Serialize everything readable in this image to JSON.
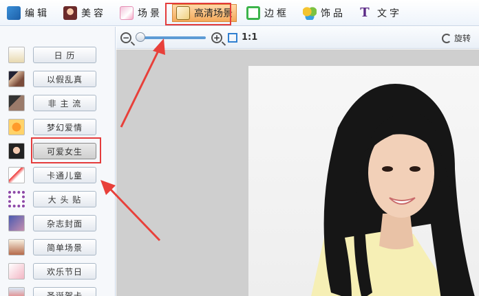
{
  "toolbar": {
    "items": [
      {
        "label": "编辑",
        "icon": "edit-icon"
      },
      {
        "label": "美容",
        "icon": "beauty-icon"
      },
      {
        "label": "场景",
        "icon": "scene-icon"
      },
      {
        "label": "高清场景",
        "icon": "hd-scene-icon"
      },
      {
        "label": "边框",
        "icon": "frame-icon"
      },
      {
        "label": "饰品",
        "icon": "decoration-icon"
      },
      {
        "label": "文字",
        "icon": "text-icon"
      }
    ],
    "active_index": 3,
    "text_glyph": "T"
  },
  "sidebar": {
    "items": [
      {
        "label": "日 历"
      },
      {
        "label": "以假乱真"
      },
      {
        "label": "非 主 流"
      },
      {
        "label": "梦幻爱情"
      },
      {
        "label": "可爱女生"
      },
      {
        "label": "卡通儿童"
      },
      {
        "label": "大 头 贴"
      },
      {
        "label": "杂志封面"
      },
      {
        "label": "简单场景"
      },
      {
        "label": "欢乐节日"
      },
      {
        "label": "圣诞贺卡"
      }
    ],
    "selected_index": 4
  },
  "viewer": {
    "zoom_out": "−",
    "zoom_in": "+",
    "zoom_ratio": "1:1",
    "rotate_label": "旋转",
    "zoom_level": 0.05
  },
  "colors": {
    "highlight": "#e43b3b",
    "accent": "#5d9bd5",
    "active_tab": "#f4a95a"
  }
}
